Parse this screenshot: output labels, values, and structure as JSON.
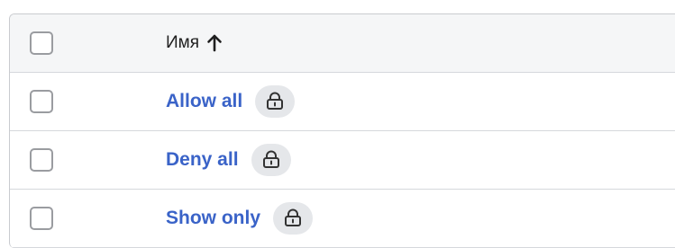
{
  "table": {
    "header": {
      "name_label": "Имя",
      "sort_direction": "ascending"
    },
    "rows": [
      {
        "name": "Allow all",
        "locked": true
      },
      {
        "name": "Deny all",
        "locked": true
      },
      {
        "name": "Show only",
        "locked": true
      }
    ]
  },
  "icons": {
    "sort": "arrow-up-icon",
    "lock": "lock-icon"
  },
  "colors": {
    "link": "#3a63c8",
    "header_bg": "#f5f6f7",
    "badge_bg": "#e5e7ea",
    "border": "#c9cbcf"
  }
}
